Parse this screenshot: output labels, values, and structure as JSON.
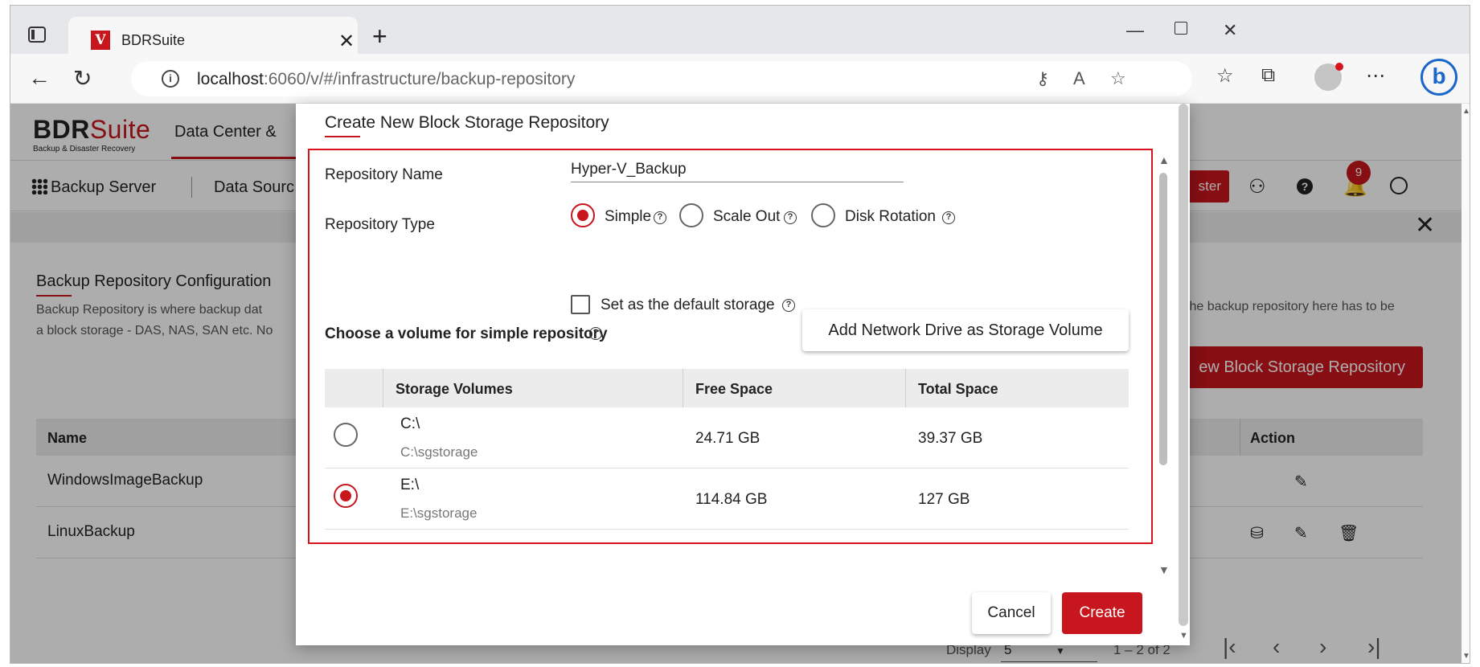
{
  "browser": {
    "tab_title": "BDRSuite",
    "favicon_letter": "V",
    "url_host": "localhost",
    "url_path": ":6060/v/#/infrastructure/backup-repository",
    "close_glyph": "✕",
    "new_tab_glyph": "+"
  },
  "app": {
    "logo_main_a": "BDR",
    "logo_main_b": "Suite",
    "logo_sub": "Backup & Disaster Recovery",
    "top_nav": "Data Center &",
    "subnav": {
      "backup_server": "Backup Server",
      "data_source": "Data Sourc"
    },
    "cluster_button": "ster",
    "notification_count": "9",
    "section_title": "Backup Repository Configuration",
    "section_desc_line1": "Backup Repository is where backup dat",
    "section_desc_line2": "a block storage - DAS, NAS, SAN etc. No",
    "section_desc_right": "the backup repository here has to be",
    "create_repo_button": "ew Block Storage Repository",
    "table": {
      "headers": {
        "name": "Name",
        "action": "Action"
      },
      "rows": [
        {
          "name": "WindowsImageBackup"
        },
        {
          "name": "LinuxBackup"
        }
      ]
    },
    "pager": {
      "display_label": "Display",
      "page_size": "5",
      "range": "1 – 2 of 2"
    }
  },
  "modal": {
    "title": "Create New Block Storage Repository",
    "repo_name_label": "Repository Name",
    "repo_name_value": "Hyper-V_Backup",
    "repo_type_label": "Repository Type",
    "repo_types": [
      {
        "label": "Simple",
        "selected": true
      },
      {
        "label": "Scale Out",
        "selected": false
      },
      {
        "label": "Disk Rotation",
        "selected": false
      }
    ],
    "default_storage_label": "Set as the default storage",
    "default_storage_checked": false,
    "choose_volume_label": "Choose a volume for simple repository",
    "add_network_drive_button": "Add Network Drive as Storage Volume",
    "volume_table": {
      "headers": {
        "storage_volumes": "Storage Volumes",
        "free_space": "Free Space",
        "total_space": "Total Space"
      },
      "rows": [
        {
          "drive": "C:\\",
          "path": "C:\\sgstorage",
          "free": "24.71 GB",
          "total": "39.37 GB",
          "selected": false
        },
        {
          "drive": "E:\\",
          "path": "E:\\sgstorage",
          "free": "114.84 GB",
          "total": "127 GB",
          "selected": true
        }
      ]
    },
    "cancel_button": "Cancel",
    "create_button": "Create"
  },
  "colors": {
    "brand_red": "#c7161d",
    "highlight_red": "#d7141b"
  }
}
